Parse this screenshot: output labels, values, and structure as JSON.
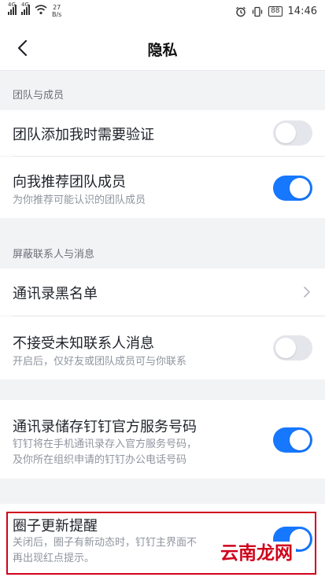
{
  "status_bar": {
    "signal_1_label": "4G",
    "signal_2_label": "4G",
    "net_speed_value": "27",
    "net_speed_unit": "B/s",
    "battery": "88",
    "time": "14:46"
  },
  "nav": {
    "title": "隐私"
  },
  "sections": [
    {
      "header": "团队与成员",
      "items": [
        {
          "title": "团队添加我时需要验证",
          "subtitle": "",
          "control": "toggle",
          "state": "off"
        },
        {
          "title": "向我推荐团队成员",
          "subtitle": "为你推荐可能认识的团队成员",
          "control": "toggle",
          "state": "on"
        }
      ]
    },
    {
      "header": "屏蔽联系人与消息",
      "items": [
        {
          "title": "通讯录黑名单",
          "subtitle": "",
          "control": "chevron"
        },
        {
          "title": "不接受未知联系人消息",
          "subtitle": "开启后，仅好友或团队成员可与你联系",
          "control": "toggle",
          "state": "off"
        }
      ]
    },
    {
      "header": "",
      "items": [
        {
          "title": "通讯录储存钉钉官方服务号码",
          "subtitle_line1": "钉钉将在手机通讯录存入官方服务号码，",
          "subtitle_line2": "及你所在组织申请的钉钉办公电话号码",
          "control": "toggle",
          "state": "on"
        }
      ]
    },
    {
      "header": "",
      "items": [
        {
          "title": "圈子更新提醒",
          "subtitle_line1": "关闭后，圈子有新动态时，钉钉主界面不",
          "subtitle_line2": "再出现红点提示。",
          "control": "toggle",
          "state": "on"
        }
      ]
    }
  ],
  "watermark": "云南龙网",
  "colors": {
    "accent": "#1677ff",
    "toggle_off": "#e5e6eb",
    "highlight": "#d0021b",
    "background": "#f2f3f5"
  }
}
